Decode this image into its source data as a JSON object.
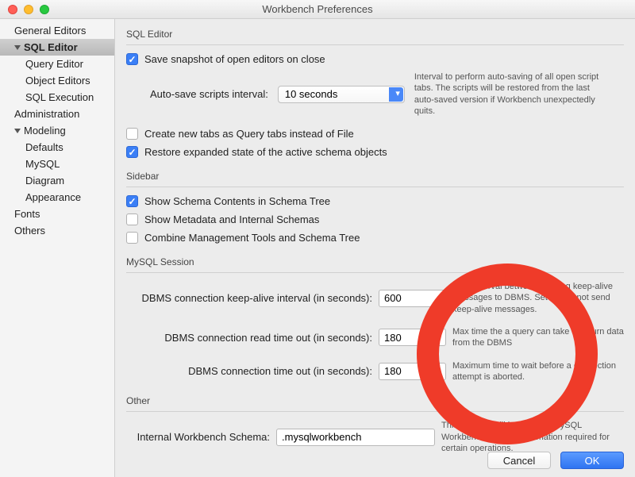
{
  "title": "Workbench Preferences",
  "sidebar": {
    "items": [
      {
        "label": "General Editors",
        "indent": 0,
        "disclosure": false
      },
      {
        "label": "SQL Editor",
        "indent": 0,
        "disclosure": true,
        "selected": true
      },
      {
        "label": "Query Editor",
        "indent": 1,
        "disclosure": false
      },
      {
        "label": "Object Editors",
        "indent": 1,
        "disclosure": false
      },
      {
        "label": "SQL Execution",
        "indent": 1,
        "disclosure": false
      },
      {
        "label": "Administration",
        "indent": 0,
        "disclosure": false
      },
      {
        "label": "Modeling",
        "indent": 0,
        "disclosure": true
      },
      {
        "label": "Defaults",
        "indent": 1,
        "disclosure": false
      },
      {
        "label": "MySQL",
        "indent": 1,
        "disclosure": false
      },
      {
        "label": "Diagram",
        "indent": 1,
        "disclosure": false
      },
      {
        "label": "Appearance",
        "indent": 1,
        "disclosure": false
      },
      {
        "label": "Fonts",
        "indent": 0,
        "disclosure": false
      },
      {
        "label": "Others",
        "indent": 0,
        "disclosure": false
      }
    ]
  },
  "groups": {
    "sql_editor": "SQL Editor",
    "sidebar": "Sidebar",
    "mysql_session": "MySQL Session",
    "other": "Other"
  },
  "sql_editor": {
    "save_snapshot": {
      "label": "Save snapshot of open editors on close",
      "checked": true
    },
    "autosave_label": "Auto-save scripts interval:",
    "autosave_value": "10 seconds",
    "autosave_hint": "Interval to perform auto-saving of all open script tabs. The scripts will be restored from the last auto-saved version if Workbench unexpectedly quits.",
    "new_tabs": {
      "label": "Create new tabs as Query tabs instead of File",
      "checked": false
    },
    "restore_expanded": {
      "label": "Restore expanded state of the active schema objects",
      "checked": true
    }
  },
  "sidebar_group": {
    "show_schema": {
      "label": "Show Schema Contents in Schema Tree",
      "checked": true
    },
    "show_metadata": {
      "label": "Show Metadata and Internal Schemas",
      "checked": false
    },
    "combine": {
      "label": "Combine Management Tools and Schema Tree",
      "checked": false
    }
  },
  "session": {
    "keepalive": {
      "label": "DBMS connection keep-alive interval (in seconds):",
      "value": "600",
      "hint": "Time interval between sending keep-alive messages to DBMS. Set to 0 to not send keep-alive messages."
    },
    "read_timeout": {
      "label": "DBMS connection read time out (in seconds):",
      "value": "180",
      "hint": "Max time the a query can take to return data from the DBMS"
    },
    "conn_timeout": {
      "label": "DBMS connection time out (in seconds):",
      "value": "180",
      "hint": "Maximum time to wait before a connection attempt is aborted."
    }
  },
  "other": {
    "schema_label": "Internal Workbench Schema:",
    "schema_value": ".mysqlworkbench",
    "schema_hint": "This schema will be used by MySQL Workbench to store information required for certain operations."
  },
  "buttons": {
    "cancel": "Cancel",
    "ok": "OK"
  }
}
